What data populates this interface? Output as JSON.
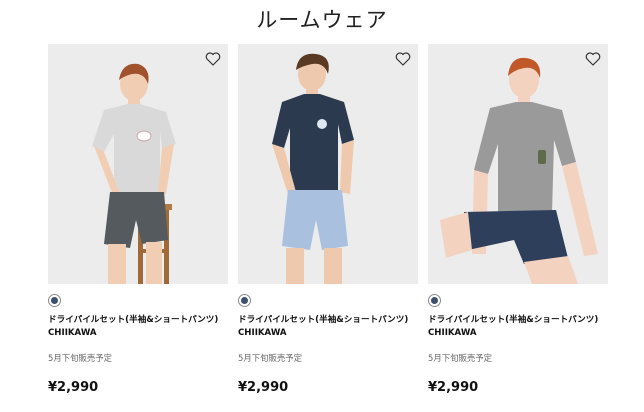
{
  "section": {
    "title": "ルームウェア"
  },
  "products": [
    {
      "name": "ドライパイルセット(半袖&ショートパンツ)",
      "brand": "CHIIKAWA",
      "status": "5月下旬販売予定",
      "price": "¥2,990",
      "swatch_color": "#3b4f6e",
      "shirt_color": "#d9d9d9",
      "shorts_color": "#555a5e",
      "hair_color": "#a0522d"
    },
    {
      "name": "ドライパイルセット(半袖&ショートパンツ)",
      "brand": "CHIIKAWA",
      "status": "5月下旬販売予定",
      "price": "¥2,990",
      "swatch_color": "#3b4f6e",
      "shirt_color": "#2b3a4e",
      "shorts_color": "#a9c1df",
      "hair_color": "#5a3a22"
    },
    {
      "name": "ドライパイルセット(半袖&ショートパンツ)",
      "brand": "CHIIKAWA",
      "status": "5月下旬販売予定",
      "price": "¥2,990",
      "swatch_color": "#3b4f6e",
      "shirt_color": "#9a9a9a",
      "shorts_color": "#2e3f5c",
      "hair_color": "#c0582a"
    }
  ]
}
